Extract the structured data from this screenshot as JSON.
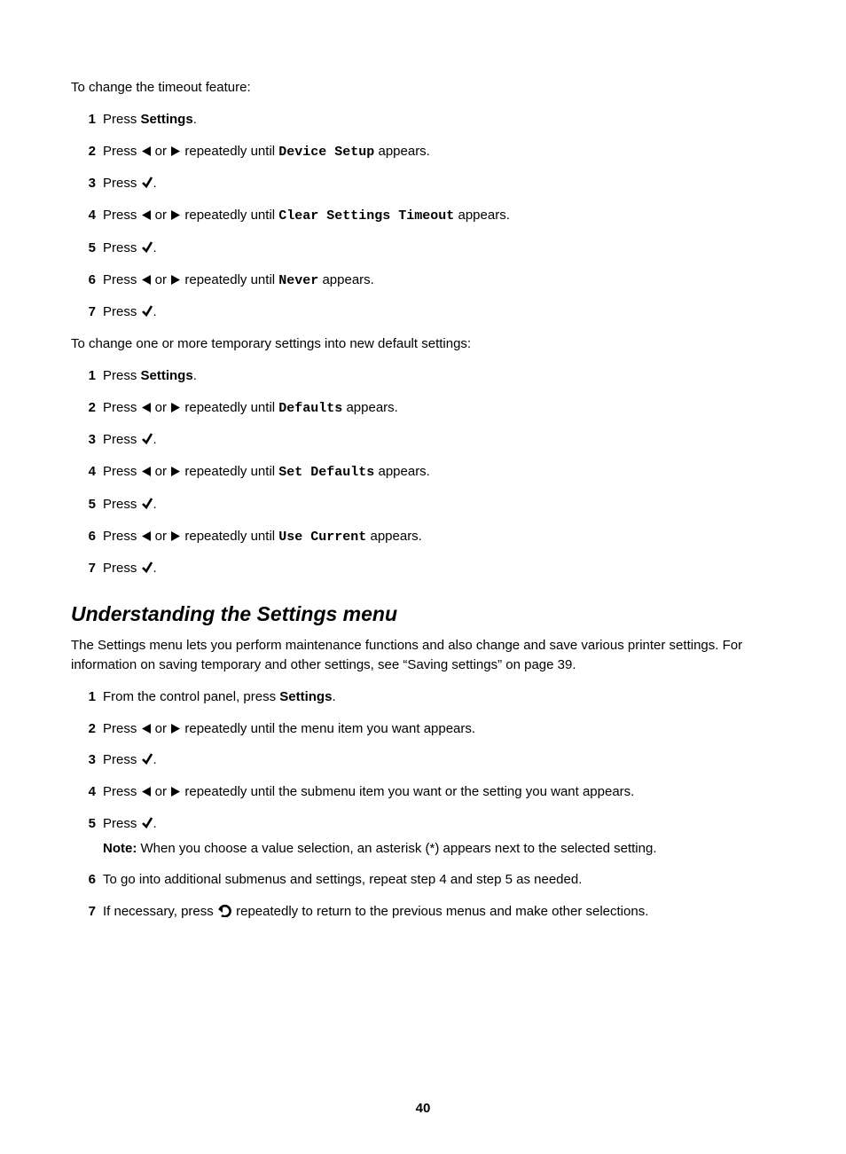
{
  "intro1": "To change the timeout feature:",
  "listA": {
    "s1_press": "Press ",
    "s1_bold": "Settings",
    "s1_end": ".",
    "s2_a": "Press ",
    "s2_or": " or ",
    "s2_b": " repeatedly until ",
    "s2_mono": "Device Setup",
    "s2_c": " appears.",
    "s3": "Press ",
    "s3_end": ".",
    "s4_a": "Press ",
    "s4_or": " or ",
    "s4_b": " repeatedly until ",
    "s4_mono": "Clear Settings Timeout",
    "s4_c": " appears.",
    "s5": "Press ",
    "s5_end": ".",
    "s6_a": "Press ",
    "s6_or": " or ",
    "s6_b": " repeatedly until ",
    "s6_mono": "Never",
    "s6_c": " appears.",
    "s7": "Press ",
    "s7_end": "."
  },
  "intro2": "To change one or more temporary settings into new default settings:",
  "listB": {
    "s1_press": "Press ",
    "s1_bold": "Settings",
    "s1_end": ".",
    "s2_a": "Press ",
    "s2_or": " or ",
    "s2_b": " repeatedly until ",
    "s2_mono": "Defaults",
    "s2_c": " appears.",
    "s3": "Press ",
    "s3_end": ".",
    "s4_a": "Press ",
    "s4_or": " or ",
    "s4_b": " repeatedly until ",
    "s4_mono": "Set Defaults",
    "s4_c": " appears.",
    "s5": "Press ",
    "s5_end": ".",
    "s6_a": "Press ",
    "s6_or": " or ",
    "s6_b": " repeatedly until ",
    "s6_mono": "Use Current",
    "s6_c": " appears.",
    "s7": "Press ",
    "s7_end": "."
  },
  "heading": "Understanding the Settings menu",
  "heading_para": "The Settings menu lets you perform maintenance functions and also change and save various printer settings. For information on saving temporary and other settings, see “Saving settings” on page 39.",
  "listC": {
    "s1_a": "From the control panel, press ",
    "s1_bold": "Settings",
    "s1_end": ".",
    "s2_a": "Press ",
    "s2_or": " or ",
    "s2_b": " repeatedly until the menu item you want appears.",
    "s3": "Press ",
    "s3_end": ".",
    "s4_a": "Press ",
    "s4_or": " or ",
    "s4_b": " repeatedly until the submenu item you want or the setting you want appears.",
    "s5": "Press ",
    "s5_end": ".",
    "note_label": "Note:",
    "note_text": " When you choose a value selection, an asterisk (*) appears next to the selected setting.",
    "s6": "To go into additional submenus and settings, repeat step 4 and step 5 as needed.",
    "s7_a": "If necessary, press ",
    "s7_b": " repeatedly to return to the previous menus and make other selections."
  },
  "nums": {
    "n1": "1",
    "n2": "2",
    "n3": "3",
    "n4": "4",
    "n5": "5",
    "n6": "6",
    "n7": "7"
  },
  "page_number": "40"
}
